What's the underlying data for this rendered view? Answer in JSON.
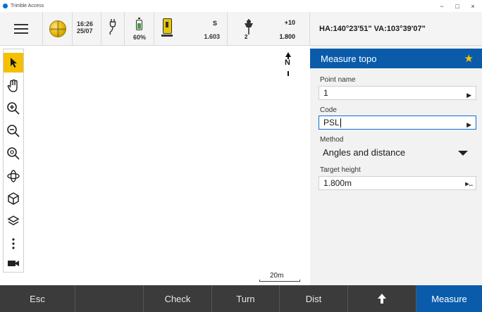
{
  "window": {
    "title": "Trimble Access",
    "minimize_label": "−",
    "maximize_label": "□",
    "close_label": "×"
  },
  "status": {
    "time": "16:26",
    "date": "25/07",
    "battery_percent": "60%",
    "battery_level": 0.6,
    "instrument_label": "S",
    "instrument_height": "1.603",
    "target_number": "2",
    "target_offset": "+10",
    "target_height": "1.800",
    "angles": "HA:140°23'51\"  VA:103°39'07\""
  },
  "map": {
    "north_label": "N",
    "scale_label": "20m"
  },
  "panel": {
    "title": "Measure topo",
    "point_name_label": "Point name",
    "point_name_value": "1",
    "code_label": "Code",
    "code_value": "PSL",
    "method_label": "Method",
    "method_value": "Angles and distance",
    "target_height_label": "Target height",
    "target_height_value": "1.800m"
  },
  "softkeys": {
    "esc": "Esc",
    "empty": "",
    "check": "Check",
    "turn": "Turn",
    "dist": "Dist",
    "up_icon": "up-arrow-icon",
    "measure": "Measure"
  },
  "colors": {
    "accent_blue": "#0a5cab",
    "toolbar_active": "#f5c000",
    "softkey_bg": "#3b3b3b",
    "star": "#f7c600"
  }
}
